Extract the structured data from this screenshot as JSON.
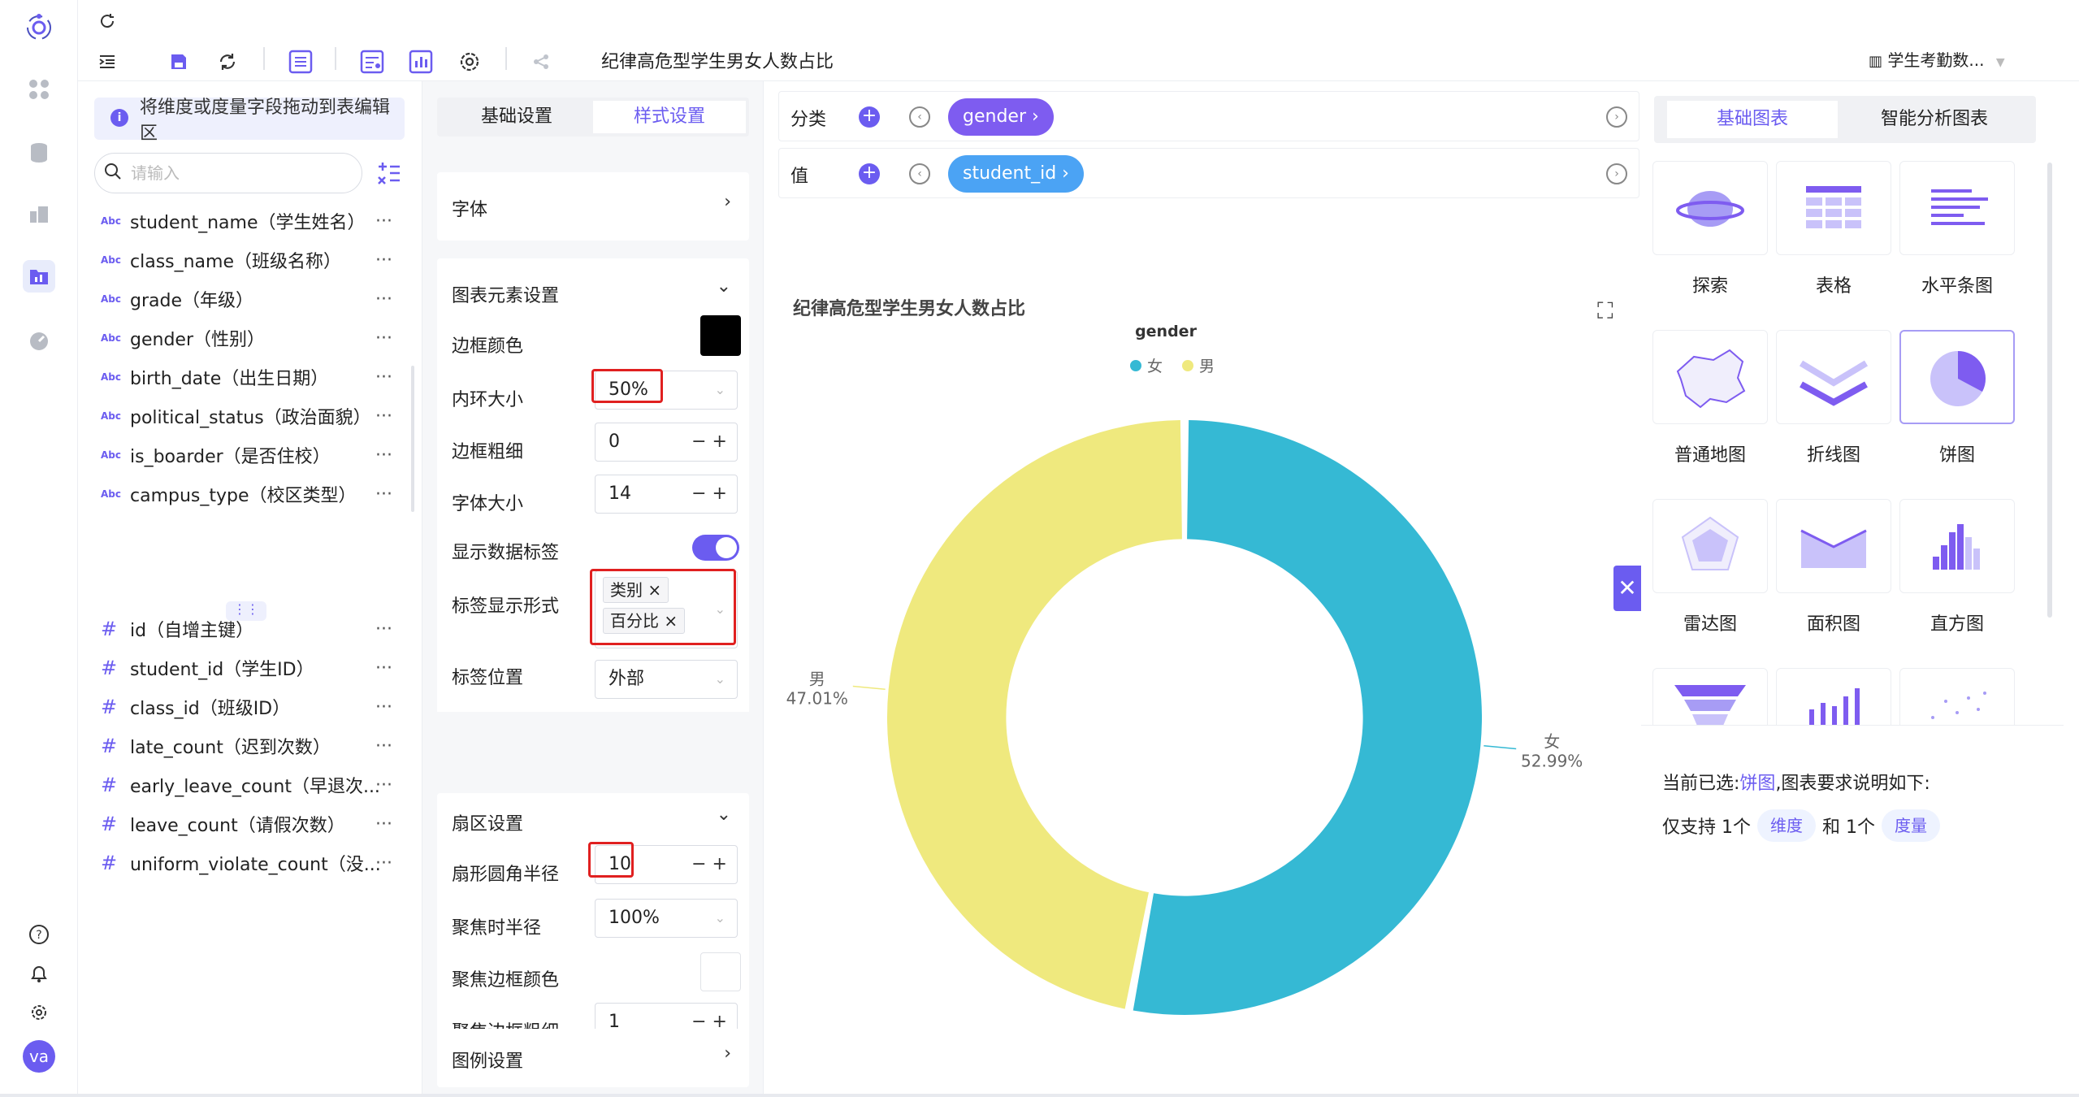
{
  "toolbar": {
    "title": "纪律高危型学生男女人数占比",
    "dataset": "学生考勤数..."
  },
  "fields": {
    "tip": "将维度或度量字段拖动到表编辑区",
    "search_placeholder": "请输入",
    "dimensions": [
      {
        "type": "Abc",
        "label": "student_name（学生姓名）"
      },
      {
        "type": "Abc",
        "label": "class_name（班级名称）"
      },
      {
        "type": "Abc",
        "label": "grade（年级）"
      },
      {
        "type": "Abc",
        "label": "gender（性别）"
      },
      {
        "type": "Abc",
        "label": "birth_date（出生日期）"
      },
      {
        "type": "Abc",
        "label": "political_status（政治面貌）"
      },
      {
        "type": "Abc",
        "label": "is_boarder（是否住校）"
      },
      {
        "type": "Abc",
        "label": "campus_type（校区类型）"
      }
    ],
    "measures": [
      {
        "type": "#",
        "label": "id（自增主键）"
      },
      {
        "type": "#",
        "label": "student_id（学生ID）"
      },
      {
        "type": "#",
        "label": "class_id（班级ID）"
      },
      {
        "type": "#",
        "label": "late_count（迟到次数）"
      },
      {
        "type": "#",
        "label": "early_leave_count（早退次..."
      },
      {
        "type": "#",
        "label": "leave_count（请假次数）"
      },
      {
        "type": "#",
        "label": "uniform_violate_count（没..."
      }
    ],
    "more": "···"
  },
  "settings": {
    "tabs": [
      "基础设置",
      "样式设置"
    ],
    "font_section": "字体",
    "element_section": "图表元素设置",
    "border_color": "边框颜色",
    "inner_radius_label": "内环大小",
    "inner_radius": "50%",
    "border_width_label": "边框粗细",
    "border_width": "0",
    "font_size_label": "字体大小",
    "font_size": "14",
    "show_labels": "显示数据标签",
    "label_format_label": "标签显示形式",
    "label_formats": [
      "类别",
      "百分比"
    ],
    "label_position_label": "标签位置",
    "label_position": "外部",
    "sector_section": "扇区设置",
    "corner_radius_label": "扇形圆角半径",
    "corner_radius": "10",
    "focus_radius_label": "聚焦时半径",
    "focus_radius": "100%",
    "focus_border_color": "聚焦边框颜色",
    "focus_border_width_label": "聚焦边框粗细",
    "focus_border_width": "1",
    "legend_section": "图例设置"
  },
  "shelves": {
    "category_label": "分类",
    "category_field": "gender ›",
    "value_label": "值",
    "value_field": "student_id ›"
  },
  "chart_data": {
    "type": "pie",
    "title": "纪律高危型学生男女人数占比",
    "legend_title": "gender",
    "inner_radius": 0.5,
    "series": [
      {
        "name": "女",
        "value": 52.99,
        "label": "52.99%",
        "color": "#35b9d4"
      },
      {
        "name": "男",
        "value": 47.01,
        "label": "47.01%",
        "color": "#efe97e"
      }
    ]
  },
  "gallery": {
    "tabs": [
      "基础图表",
      "智能分析图表"
    ],
    "items": [
      "探索",
      "表格",
      "水平条图",
      "普通地图",
      "折线图",
      "饼图",
      "雷达图",
      "面积图",
      "直方图"
    ],
    "selected_prefix": "当前已选:",
    "selected_name": "饼图",
    "selected_suffix": ",图表要求说明如下:",
    "req_prefix": "仅支持 1个",
    "req_dim": "维度",
    "req_mid": "和 1个",
    "req_measure": "度量"
  }
}
